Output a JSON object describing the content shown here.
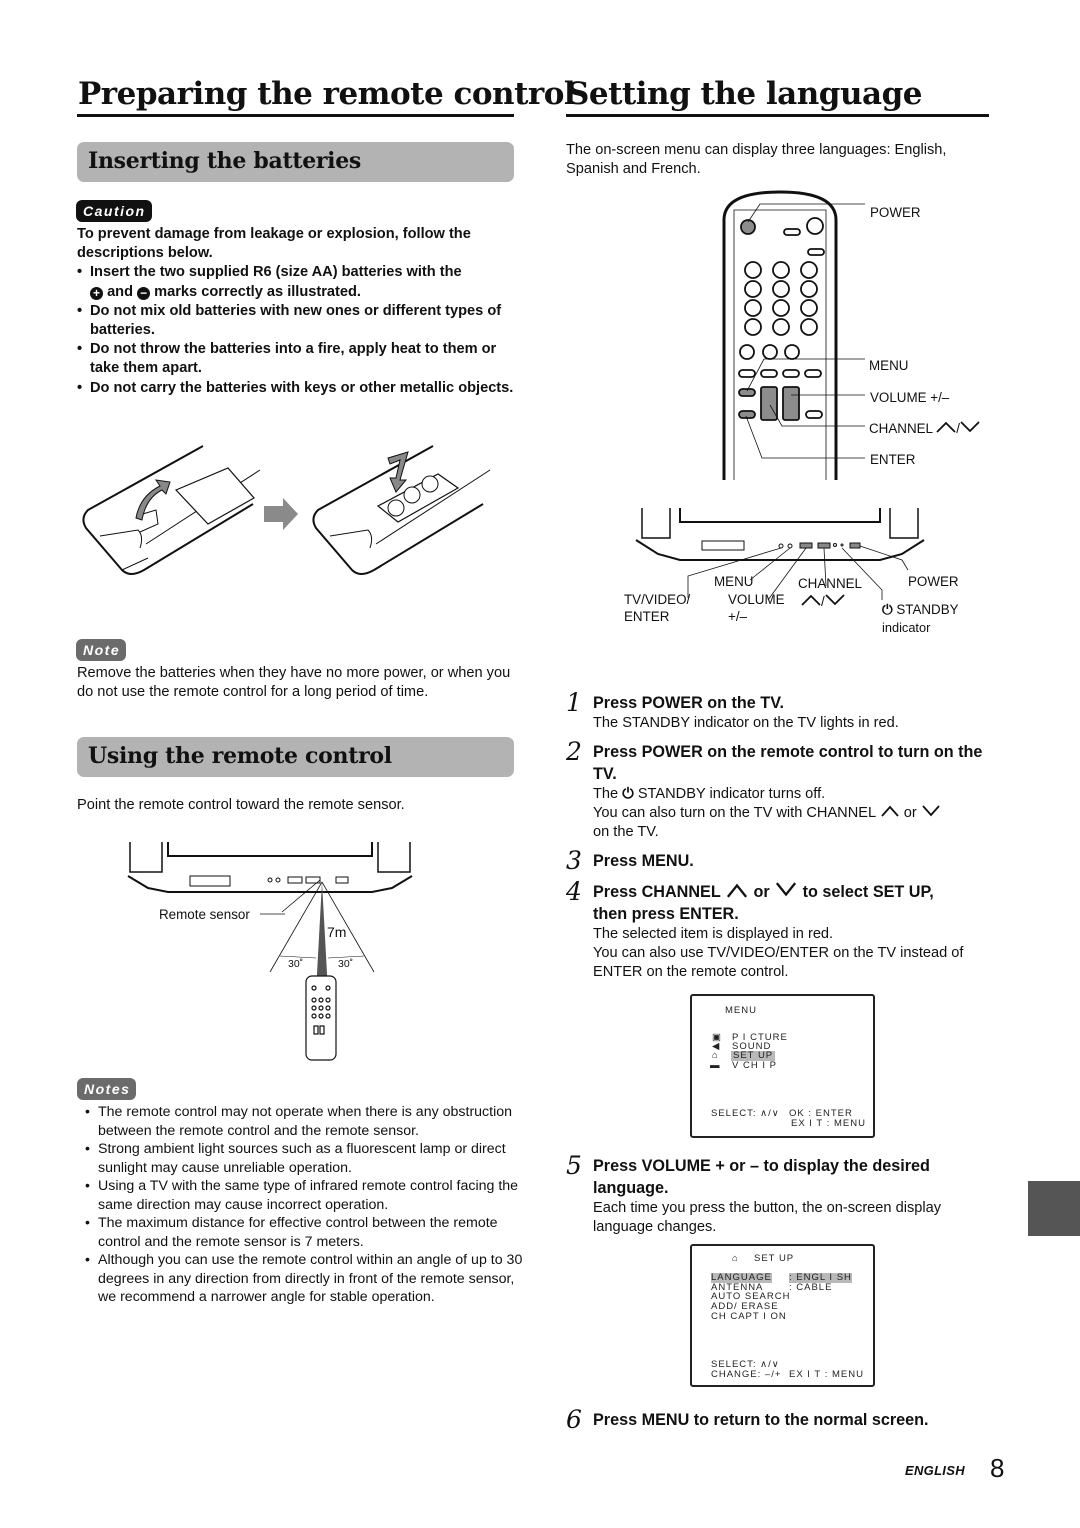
{
  "left": {
    "title": "Preparing the remote control",
    "inserting": {
      "heading": "Inserting the batteries",
      "caution_label": "Caution",
      "caution_intro": "To prevent damage from leakage or explosion, follow the descriptions below.",
      "caution_items": [
        {
          "pre": "Insert the two supplied R6 (size AA) batteries with the",
          "plus_symbol": "+",
          "and": "and",
          "minus_symbol": "−",
          "post": "marks correctly as illustrated."
        },
        {
          "text": "Do not mix old batteries with new ones or different types of batteries."
        },
        {
          "text": "Do not throw the batteries into a fire, apply heat to them or take them apart."
        },
        {
          "text": "Do not carry the batteries with keys or other metallic objects."
        }
      ],
      "note_label": "Note",
      "note_text": "Remove the batteries when they have no more power, or when you do not use the remote control for a long period of time."
    },
    "using": {
      "heading": "Using the remote control",
      "intro": "Point the remote control toward the remote sensor.",
      "diagram": {
        "sensor_label": "Remote sensor",
        "distance": "7m",
        "angle_left": "30˚",
        "angle_right": "30˚"
      },
      "notes_label": "Notes",
      "notes": [
        "The remote control may not operate when there is any obstruction between the remote control and the remote sensor.",
        "Strong ambient light sources such as a fluorescent lamp or direct sunlight may cause unreliable operation.",
        "Using a TV with the same type of infrared remote control facing the same direction may cause incorrect operation.",
        "The maximum distance for effective control between the remote control and the remote sensor is 7 meters.",
        "Although you can use the remote control within an angle of up to 30 degrees in any direction from directly in front of the remote sensor, we recommend a narrower angle for stable operation."
      ]
    }
  },
  "right": {
    "title": "Setting the language",
    "intro": "The on-screen menu can display three languages: English, Spanish and French.",
    "remote_labels": {
      "power": "POWER",
      "menu": "MENU",
      "volume": "VOLUME +/–",
      "channel": "CHANNEL",
      "enter": "ENTER"
    },
    "tv_labels": {
      "tv_video": "TV/VIDEO/",
      "tv_video_2": "ENTER",
      "menu": "MENU",
      "volume": "VOLUME",
      "volume_2": "+/–",
      "channel": "CHANNEL",
      "power": "POWER",
      "standby": "STANDBY",
      "standby_2": "indicator"
    },
    "steps": [
      {
        "num": "1",
        "title": "Press POWER on the TV.",
        "desc": [
          "The STANDBY indicator on the TV lights in red."
        ]
      },
      {
        "num": "2",
        "title": "Press POWER on the remote control to turn on the TV.",
        "desc_a_pre": "The",
        "desc_a_post": "STANDBY indicator turns off.",
        "desc_b_pre": "You can also turn on the TV with CHANNEL",
        "desc_b_or": "or",
        "desc_b_post": "on the TV."
      },
      {
        "num": "3",
        "title": "Press MENU."
      },
      {
        "num": "4",
        "title_pre": "Press CHANNEL",
        "title_or": "or",
        "title_post": "to select SET UP,",
        "title_line2": "then press ENTER.",
        "desc": [
          "The selected item is displayed in red.",
          "You can also use TV/VIDEO/ENTER on the TV instead of ENTER on the remote control."
        ]
      },
      {
        "num": "5",
        "title": "Press VOLUME + or – to display the desired language.",
        "desc": [
          "Each time you press the button, the on-screen display language changes."
        ]
      },
      {
        "num": "6",
        "title": "Press MENU to return to the normal screen."
      }
    ],
    "osd_menu": {
      "title": "MENU",
      "items": [
        "P I CTURE",
        "SOUND",
        "SET  UP",
        "V  CH I P"
      ],
      "selected_index": 2,
      "select_hint": "SELECT: ∧/∨",
      "ok_hint": "OK : ENTER",
      "exit_hint": "EX I T : MENU"
    },
    "osd_setup": {
      "title": "SET  UP",
      "rows": [
        {
          "label": "LANGUAGE",
          "value": ": ENGL I SH",
          "selected": true
        },
        {
          "label": "ANTENNA",
          "value": ": CABLE"
        },
        {
          "label": "AUTO  SEARCH",
          "value": ""
        },
        {
          "label": "ADD/ ERASE",
          "value": ""
        },
        {
          "label": "CH  CAPT I ON",
          "value": ""
        }
      ],
      "select_hint": "SELECT: ∧/∨",
      "change_hint": "CHANGE: –/+",
      "exit_hint": "EX I T : MENU"
    }
  },
  "footer": {
    "language": "ENGLISH",
    "page": "8"
  }
}
